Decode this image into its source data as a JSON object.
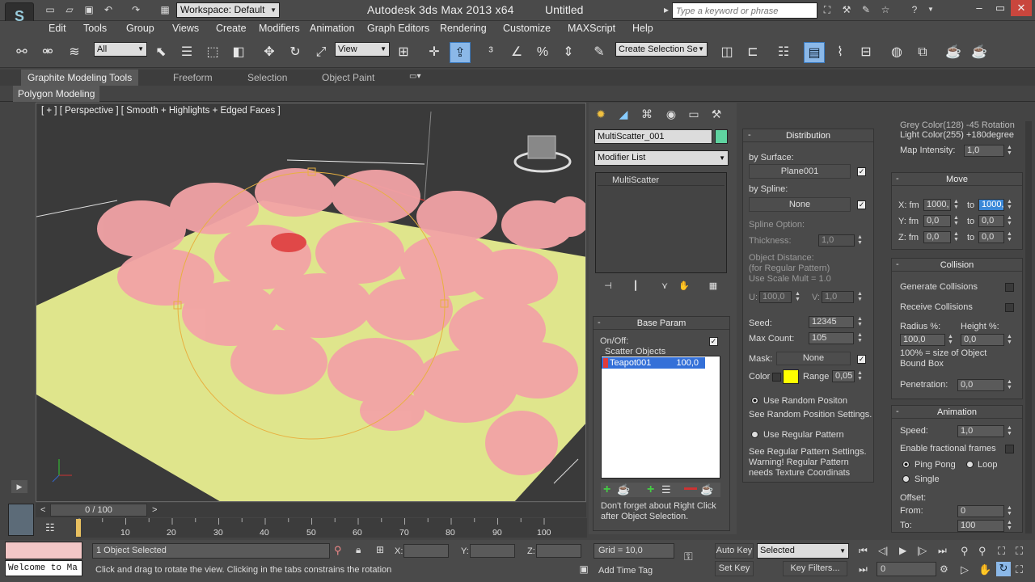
{
  "titlebar": {
    "workspace": "Workspace: Default",
    "app": "Autodesk 3ds Max  2013 x64",
    "doc": "Untitled",
    "search_placeholder": "Type a keyword or phrase"
  },
  "menu": [
    "Edit",
    "Tools",
    "Group",
    "Views",
    "Create",
    "Modifiers",
    "Animation",
    "Graph Editors",
    "Rendering",
    "Customize",
    "MAXScript",
    "Help"
  ],
  "toolbar": {
    "filter": "All",
    "refcoord": "View",
    "selset": "Create Selection Se"
  },
  "ribbon": {
    "tabs": [
      "Graphite Modeling Tools",
      "Freeform",
      "Selection",
      "Object Paint"
    ],
    "sub": "Polygon Modeling"
  },
  "viewport": {
    "label": "[ + ] [ Perspective ] [ Smooth + Highlights + Edged Faces ]"
  },
  "cmd": {
    "name": "MultiScatter_001",
    "name_color": "#5fd3a0",
    "modlist": "Modifier List",
    "stack_item": "MultiScatter"
  },
  "base": {
    "title": "Base Param",
    "onoff": "On/Off:",
    "scatter_label": "Scatter Objects",
    "item_name": "Teapot001",
    "item_val": "100,0",
    "note1": "Don't forget about Right Click",
    "note2": "after Object Selection."
  },
  "dist": {
    "title": "Distribution",
    "by_surface": "by Surface:",
    "surface_btn": "Plane001",
    "by_spline": "by Spline:",
    "spline_btn": "None",
    "spline_opt": "Spline Option:",
    "thickness": "Thickness:",
    "thickness_val": "1,0",
    "obj_dist": "Object Distance:",
    "obj_dist2": "(for Regular Pattern)",
    "obj_dist3": "Use Scale Mult = 1.0",
    "u_lbl": "U:",
    "u_val": "100,0",
    "v_lbl": "V:",
    "v_val": "1,0",
    "seed": "Seed:",
    "seed_val": "12345",
    "max_count": "Max Count:",
    "max_count_val": "105",
    "mask": "Mask:",
    "mask_btn": "None",
    "color": "Color",
    "range": "Range",
    "range_val": "0,05",
    "use_random": "Use Random Positon",
    "random_note": "See Random Position Settings.",
    "use_regular": "Use Regular Pattern",
    "reg_note1": "See Regular Pattern Settings.",
    "reg_note2": "Warning! Regular Pattern",
    "reg_note3": "needs Texture Coordinats"
  },
  "right": {
    "top1": "Grey Color(128)   -45 Rotation",
    "top2": "Light Color(255)  +180degree",
    "map_int": "Map Intensity:",
    "map_int_val": "1,0",
    "move_title": "Move",
    "x_lbl": "X: fm",
    "x_fm": "1000,",
    "x_to": "1000,",
    "y_lbl": "Y: fm",
    "y_fm": "0,0",
    "y_to": "0,0",
    "z_lbl": "Z: fm",
    "z_fm": "0,0",
    "z_to": "0,0",
    "to": "to",
    "coll_title": "Collision",
    "gen_coll": "Generate Collisions",
    "rec_coll": "Receive Collisions",
    "radius": "Radius %:",
    "height": "Height %:",
    "radius_val": "100,0",
    "height_val": "0,0",
    "size_note1": "100% = size of Object",
    "size_note2": "Bound  Box",
    "penetration": "Penetration:",
    "penetration_val": "0,0",
    "anim_title": "Animation",
    "speed": "Speed:",
    "speed_val": "1,0",
    "frac": "Enable fractional frames",
    "ping": "Ping Pong",
    "loop": "Loop",
    "single": "Single",
    "offset": "Offset:",
    "from": "From:",
    "from_val": "0",
    "to2": "To:",
    "to_val": "100"
  },
  "timeline": {
    "frame": "0 / 100",
    "ticks": [
      "10",
      "20",
      "30",
      "40",
      "50",
      "60",
      "70",
      "80",
      "90",
      "100"
    ]
  },
  "status": {
    "selected": "1 Object Selected",
    "hint": "Click and drag to rotate the view.  Clicking in the tabs constrains the rotation",
    "welcome": "Welcome to Ma",
    "x": "X:",
    "y": "Y:",
    "z": "Z:",
    "grid": "Grid = 10,0",
    "add_time_tag": "Add Time Tag",
    "auto_key": "Auto Key",
    "key_mode": "Selected",
    "set_key": "Set Key",
    "key_filters": "Key Filters...",
    "frame_val": "0"
  }
}
